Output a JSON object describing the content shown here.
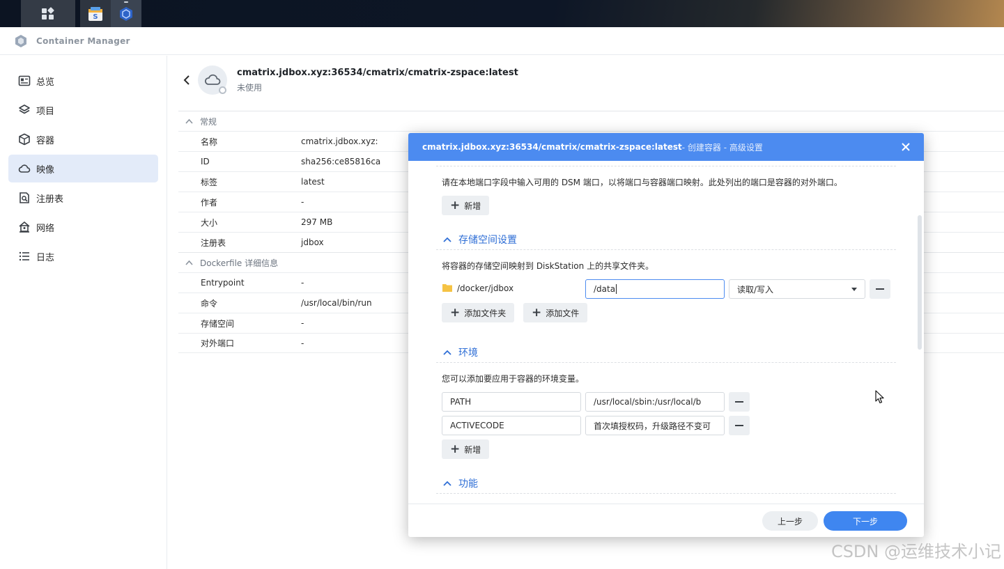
{
  "app": {
    "title": "Container Manager"
  },
  "sidebar": {
    "items": [
      {
        "label": "总览",
        "icon": "dashboard-icon",
        "active": false
      },
      {
        "label": "项目",
        "icon": "layers-icon",
        "active": false
      },
      {
        "label": "容器",
        "icon": "cube-icon",
        "active": false
      },
      {
        "label": "映像",
        "icon": "cloud-icon",
        "active": true
      },
      {
        "label": "注册表",
        "icon": "registry-search-icon",
        "active": false
      },
      {
        "label": "网络",
        "icon": "home-network-icon",
        "active": false
      },
      {
        "label": "日志",
        "icon": "list-icon",
        "active": false
      }
    ]
  },
  "image": {
    "title": "cmatrix.jdbox.xyz:36534/cmatrix/cmatrix-zspace:latest",
    "status": "未使用"
  },
  "details": {
    "general_header": "常规",
    "general_rows": [
      {
        "k": "名称",
        "v": "cmatrix.jdbox.xyz:"
      },
      {
        "k": "ID",
        "v": "sha256:ce85816ca"
      },
      {
        "k": "标签",
        "v": "latest"
      },
      {
        "k": "作者",
        "v": "-"
      },
      {
        "k": "大小",
        "v": "297 MB"
      },
      {
        "k": "注册表",
        "v": "jdbox"
      }
    ],
    "dockerfile_header": "Dockerfile 详细信息",
    "dockerfile_rows": [
      {
        "k": "Entrypoint",
        "v": "-"
      },
      {
        "k": "命令",
        "v": "/usr/local/bin/run"
      },
      {
        "k": "存储空间",
        "v": "-"
      },
      {
        "k": "对外端口",
        "v": "-"
      }
    ]
  },
  "modal": {
    "title_main": "cmatrix.jdbox.xyz:36534/cmatrix/cmatrix-zspace:latest",
    "title_sub": " - 创建容器 - 高级设置",
    "port_desc": "请在本地端口字段中输入可用的 DSM 端口，以将端口与容器端口映射。此处列出的端口是容器的对外端口。",
    "add_label": "新增",
    "storage": {
      "title": "存储空间设置",
      "desc": "将容器的存储空间映射到 DiskStation 上的共享文件夹。",
      "host_path": "/docker/jdbox",
      "mount_path": "/data",
      "mode": "读取/写入",
      "add_folder": "添加文件夹",
      "add_file": "添加文件"
    },
    "env": {
      "title": "环境",
      "desc": "您可以添加要应用于容器的环境变量。",
      "vars": [
        {
          "name": "PATH",
          "value": "/usr/local/sbin:/usr/local/b"
        },
        {
          "name": "ACTIVECODE",
          "value": "首次填授权码，升级路径不变可"
        }
      ],
      "add_label": "新增"
    },
    "features_title": "功能",
    "prev_label": "上一步",
    "next_label": "下一步"
  },
  "watermark": "CSDN @运维技术小记",
  "colors": {
    "accent": "#4c8bf0",
    "active_nav": "#e3ebf9",
    "section_title": "#2e6ed6"
  }
}
